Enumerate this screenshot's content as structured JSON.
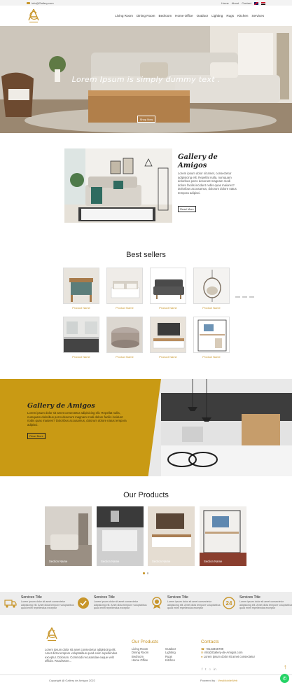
{
  "topbar": {
    "email": "info@Gallery.com",
    "links": [
      "Home",
      "About",
      "Contact"
    ]
  },
  "header": {
    "nav": [
      "Living Room",
      "Dining Room",
      "Bedroom",
      "Home Office",
      "Outdoor",
      "Lighting",
      "Rugs",
      "Kitchen",
      "Services"
    ]
  },
  "hero": {
    "headline": "Lorem Ipsum is simply dummy text .",
    "button": "Shop Now"
  },
  "about": {
    "title": "Gallery de Amigos",
    "text": "Lorem ipsum dolor sit amet, consectetur adipisicing elit. Repellat nulla, numquam doloribus porro deserunt magnam modi dolore facilis incidunt nobis quas maiores? Doloribus accusamus, dolorum dolore natus tempora adipisci.",
    "button": "Read More"
  },
  "best_sellers": {
    "title": "Best sellers",
    "items": [
      {
        "name": "Product Name"
      },
      {
        "name": "Product Name"
      },
      {
        "name": "Product Name"
      },
      {
        "name": "Product Name"
      },
      {
        "name": "Product Name"
      },
      {
        "name": "Product Name"
      },
      {
        "name": "Product Name"
      },
      {
        "name": "Product Name"
      }
    ]
  },
  "band": {
    "title": "Gallery de Amigos",
    "text": "Lorem ipsum dolor sit amet consectetur adipisicing elit. Repellat nulla, numquam doloribus porro deserunt magnam modi dolore facilis incidunt nobis quas maiores? Doloribus accusamus, dolorum dolore natus tempora adipisci.",
    "button": "Read More"
  },
  "our_products": {
    "title": "Our Products",
    "items": [
      {
        "label": "Section Name"
      },
      {
        "label": "Section Name"
      },
      {
        "label": "Section Name"
      },
      {
        "label": "Section Name"
      }
    ]
  },
  "services": [
    {
      "title": "Services Title",
      "text": "Lorem ipsum dolor sit amet consectetur adipisicing elit. Amet dicta tempore voluptatibus quod enim repellendus exceptur"
    },
    {
      "title": "Services Title",
      "text": "Lorem ipsum dolor sit amet consectetur adipisicing elit. Amet dicta tempore voluptatibus quod enim repellendus exceptur"
    },
    {
      "title": "Services Title",
      "text": "Lorem ipsum dolor sit amet consectetur adipisicing elit. Amet dicta tempore voluptatibus quod enim repellendus exceptur"
    },
    {
      "title": "Services Title",
      "text": "Lorem ipsum dolor sit amet consectetur adipisicing elit. Amet dicta tempore voluptatibus quod enim repellendus exceptur"
    }
  ],
  "footer": {
    "about": "Lorem ipsum dolor sit amet consectetur adipisicing elit. Amet dicta tempore voluptatibus quod enim repellendus exceptur. Dolorum. Commodi recusandae eaque velit officiis. Read More...",
    "products_title": "Our Products",
    "products_col1": [
      "Living Room",
      "Dining Room",
      "Bedroom",
      "Home Office"
    ],
    "products_col2": [
      "Outdoor",
      "Lighting",
      "Rugs",
      "Kitchen"
    ],
    "contacts_title": "Contacts",
    "contacts": [
      "+0123456789",
      "info@Gallery-de-Amigos.com",
      "Lorem ipsum dolor sit amet consectetur"
    ],
    "copyright": "Copyright @ Gallery de Amigos 2022",
    "powered_by": "Powered by :",
    "powered_name": "VeraMobileWeb"
  },
  "colors": {
    "gold": "#c8962b",
    "band": "#c99a14",
    "whatsapp": "#25d366"
  }
}
